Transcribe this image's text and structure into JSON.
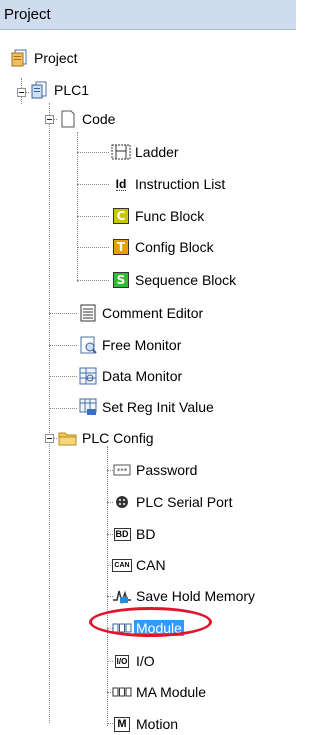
{
  "header": {
    "title": "Project"
  },
  "tree": {
    "project": "Project",
    "plc": "PLC1",
    "code": "Code",
    "ladder": "Ladder",
    "instruction_list": "Instruction List",
    "func_block": "Func Block",
    "config_block": "Config Block",
    "sequence_block": "Sequence Block",
    "comment_editor": "Comment Editor",
    "free_monitor": "Free Monitor",
    "data_monitor": "Data Monitor",
    "set_reg_init": "Set Reg Init Value",
    "plc_config": "PLC Config",
    "password": "Password",
    "plc_serial_port": "PLC Serial Port",
    "bd": "BD",
    "can": "CAN",
    "save_hold_memory": "Save Hold Memory",
    "module": "Module",
    "io": "I/O",
    "ma_module": "MA Module",
    "motion": "Motion"
  },
  "icons": {
    "func_block_letter": "C",
    "config_block_letter": "T",
    "sequence_block_letter": "S",
    "bd_text": "BD",
    "can_text": "CAN",
    "io_text": "I/O",
    "motion_text": "M",
    "il_text": "Id"
  },
  "colors": {
    "header_bg": "#cfdcee",
    "selection": "#3399ff",
    "highlight": "#e0142c",
    "func_block": "#c8c800",
    "config_block": "#e8a000",
    "sequence_block": "#33bb33"
  }
}
